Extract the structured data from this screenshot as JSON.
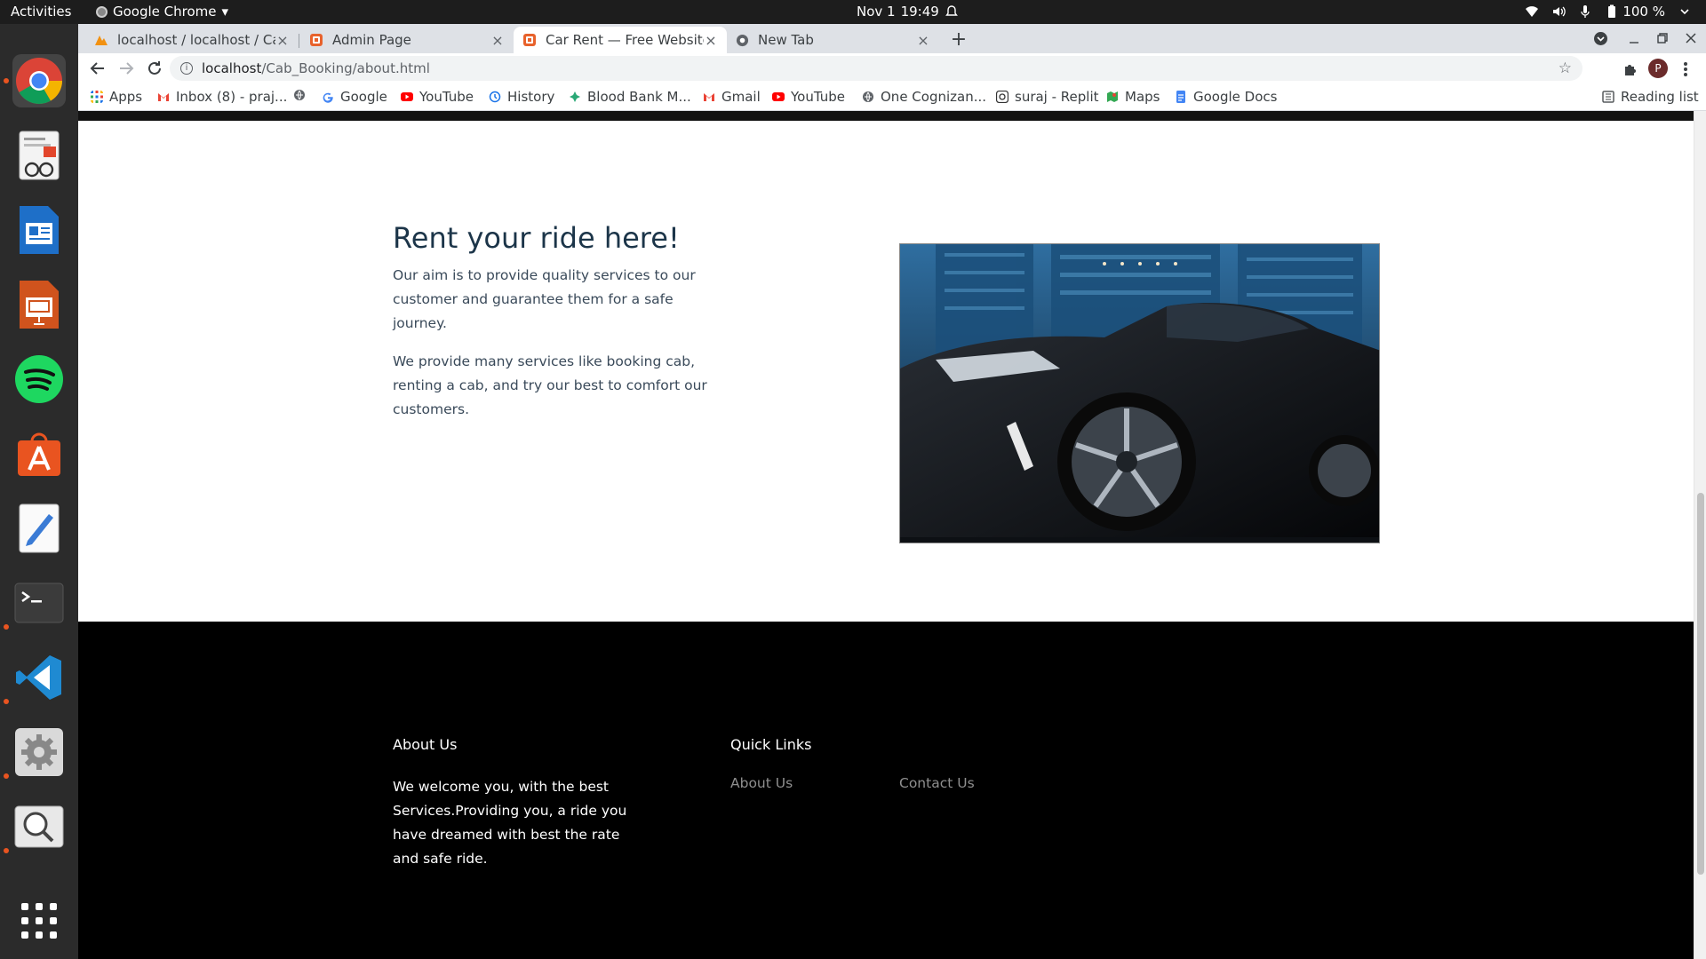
{
  "system_bar": {
    "activities": "Activities",
    "app_name": "Google Chrome",
    "app_caret": "▾",
    "date": "Nov 1",
    "time": "19:49",
    "battery": "100 %"
  },
  "dock": {
    "items": [
      {
        "name": "chrome-app-icon",
        "running": true
      },
      {
        "name": "document-viewer-app-icon",
        "running": false
      },
      {
        "name": "libreoffice-writer-app-icon",
        "running": false
      },
      {
        "name": "libreoffice-impress-app-icon",
        "running": false
      },
      {
        "name": "spotify-app-icon",
        "running": false
      },
      {
        "name": "software-center-app-icon",
        "running": false
      },
      {
        "name": "text-editor-app-icon",
        "running": false
      },
      {
        "name": "terminal-app-icon",
        "running": true
      },
      {
        "name": "vscode-app-icon",
        "running": true
      },
      {
        "name": "settings-app-icon",
        "running": true
      },
      {
        "name": "image-viewer-app-icon",
        "running": true
      },
      {
        "name": "show-applications-icon",
        "running": false
      }
    ]
  },
  "tabs": [
    {
      "title": "localhost / localhost / Cab",
      "close": "×",
      "active": false
    },
    {
      "title": "Admin Page",
      "close": "×",
      "active": false
    },
    {
      "title": "Car Rent — Free Website",
      "close": "×",
      "active": true
    },
    {
      "title": "New Tab",
      "close": "×",
      "active": false
    }
  ],
  "toolbar": {
    "new_tab": "+",
    "url_host": "localhost",
    "url_path": "/Cab_Booking/about.html",
    "star": "☆",
    "profile_initial": "P"
  },
  "bookmarks": {
    "items": [
      {
        "label": "Apps",
        "icon": "apps-grid-icon"
      },
      {
        "label": "Inbox (8) - praj...",
        "icon": "gmail-icon"
      },
      {
        "label": "",
        "icon": "globe-icon"
      },
      {
        "label": "Google",
        "icon": "google-icon"
      },
      {
        "label": "YouTube",
        "icon": "youtube-icon"
      },
      {
        "label": "History",
        "icon": "history-icon"
      },
      {
        "label": "Blood Bank M...",
        "icon": "blood-bank-icon"
      },
      {
        "label": "Gmail",
        "icon": "gmail-icon"
      },
      {
        "label": "YouTube",
        "icon": "youtube-icon"
      },
      {
        "label": "One Cognizan...",
        "icon": "globe-icon"
      },
      {
        "label": "suraj - Replit",
        "icon": "replit-icon"
      },
      {
        "label": "Maps",
        "icon": "maps-icon"
      },
      {
        "label": "Google Docs",
        "icon": "google-docs-icon"
      }
    ],
    "reading_list": "Reading list"
  },
  "about": {
    "heading": "Rent your ride here!",
    "para1": "Our aim is to provide quality services to our customer and guarantee them for a safe journey.",
    "para2": "We provide many services like booking cab, renting a cab, and try our best to comfort our customers."
  },
  "footer": {
    "about_title": "About Us",
    "about_text": "We welcome you, with the best Services.Providing you, a ride you have dreamed with best the rate and safe ride.",
    "links_title": "Quick Links",
    "link_about": "About Us",
    "link_contact": "Contact Us"
  },
  "colors": {
    "heading": "#1c3549",
    "body_text": "#3a4a5a",
    "footer_bg": "#000000",
    "footer_link": "#8f8f8f"
  }
}
